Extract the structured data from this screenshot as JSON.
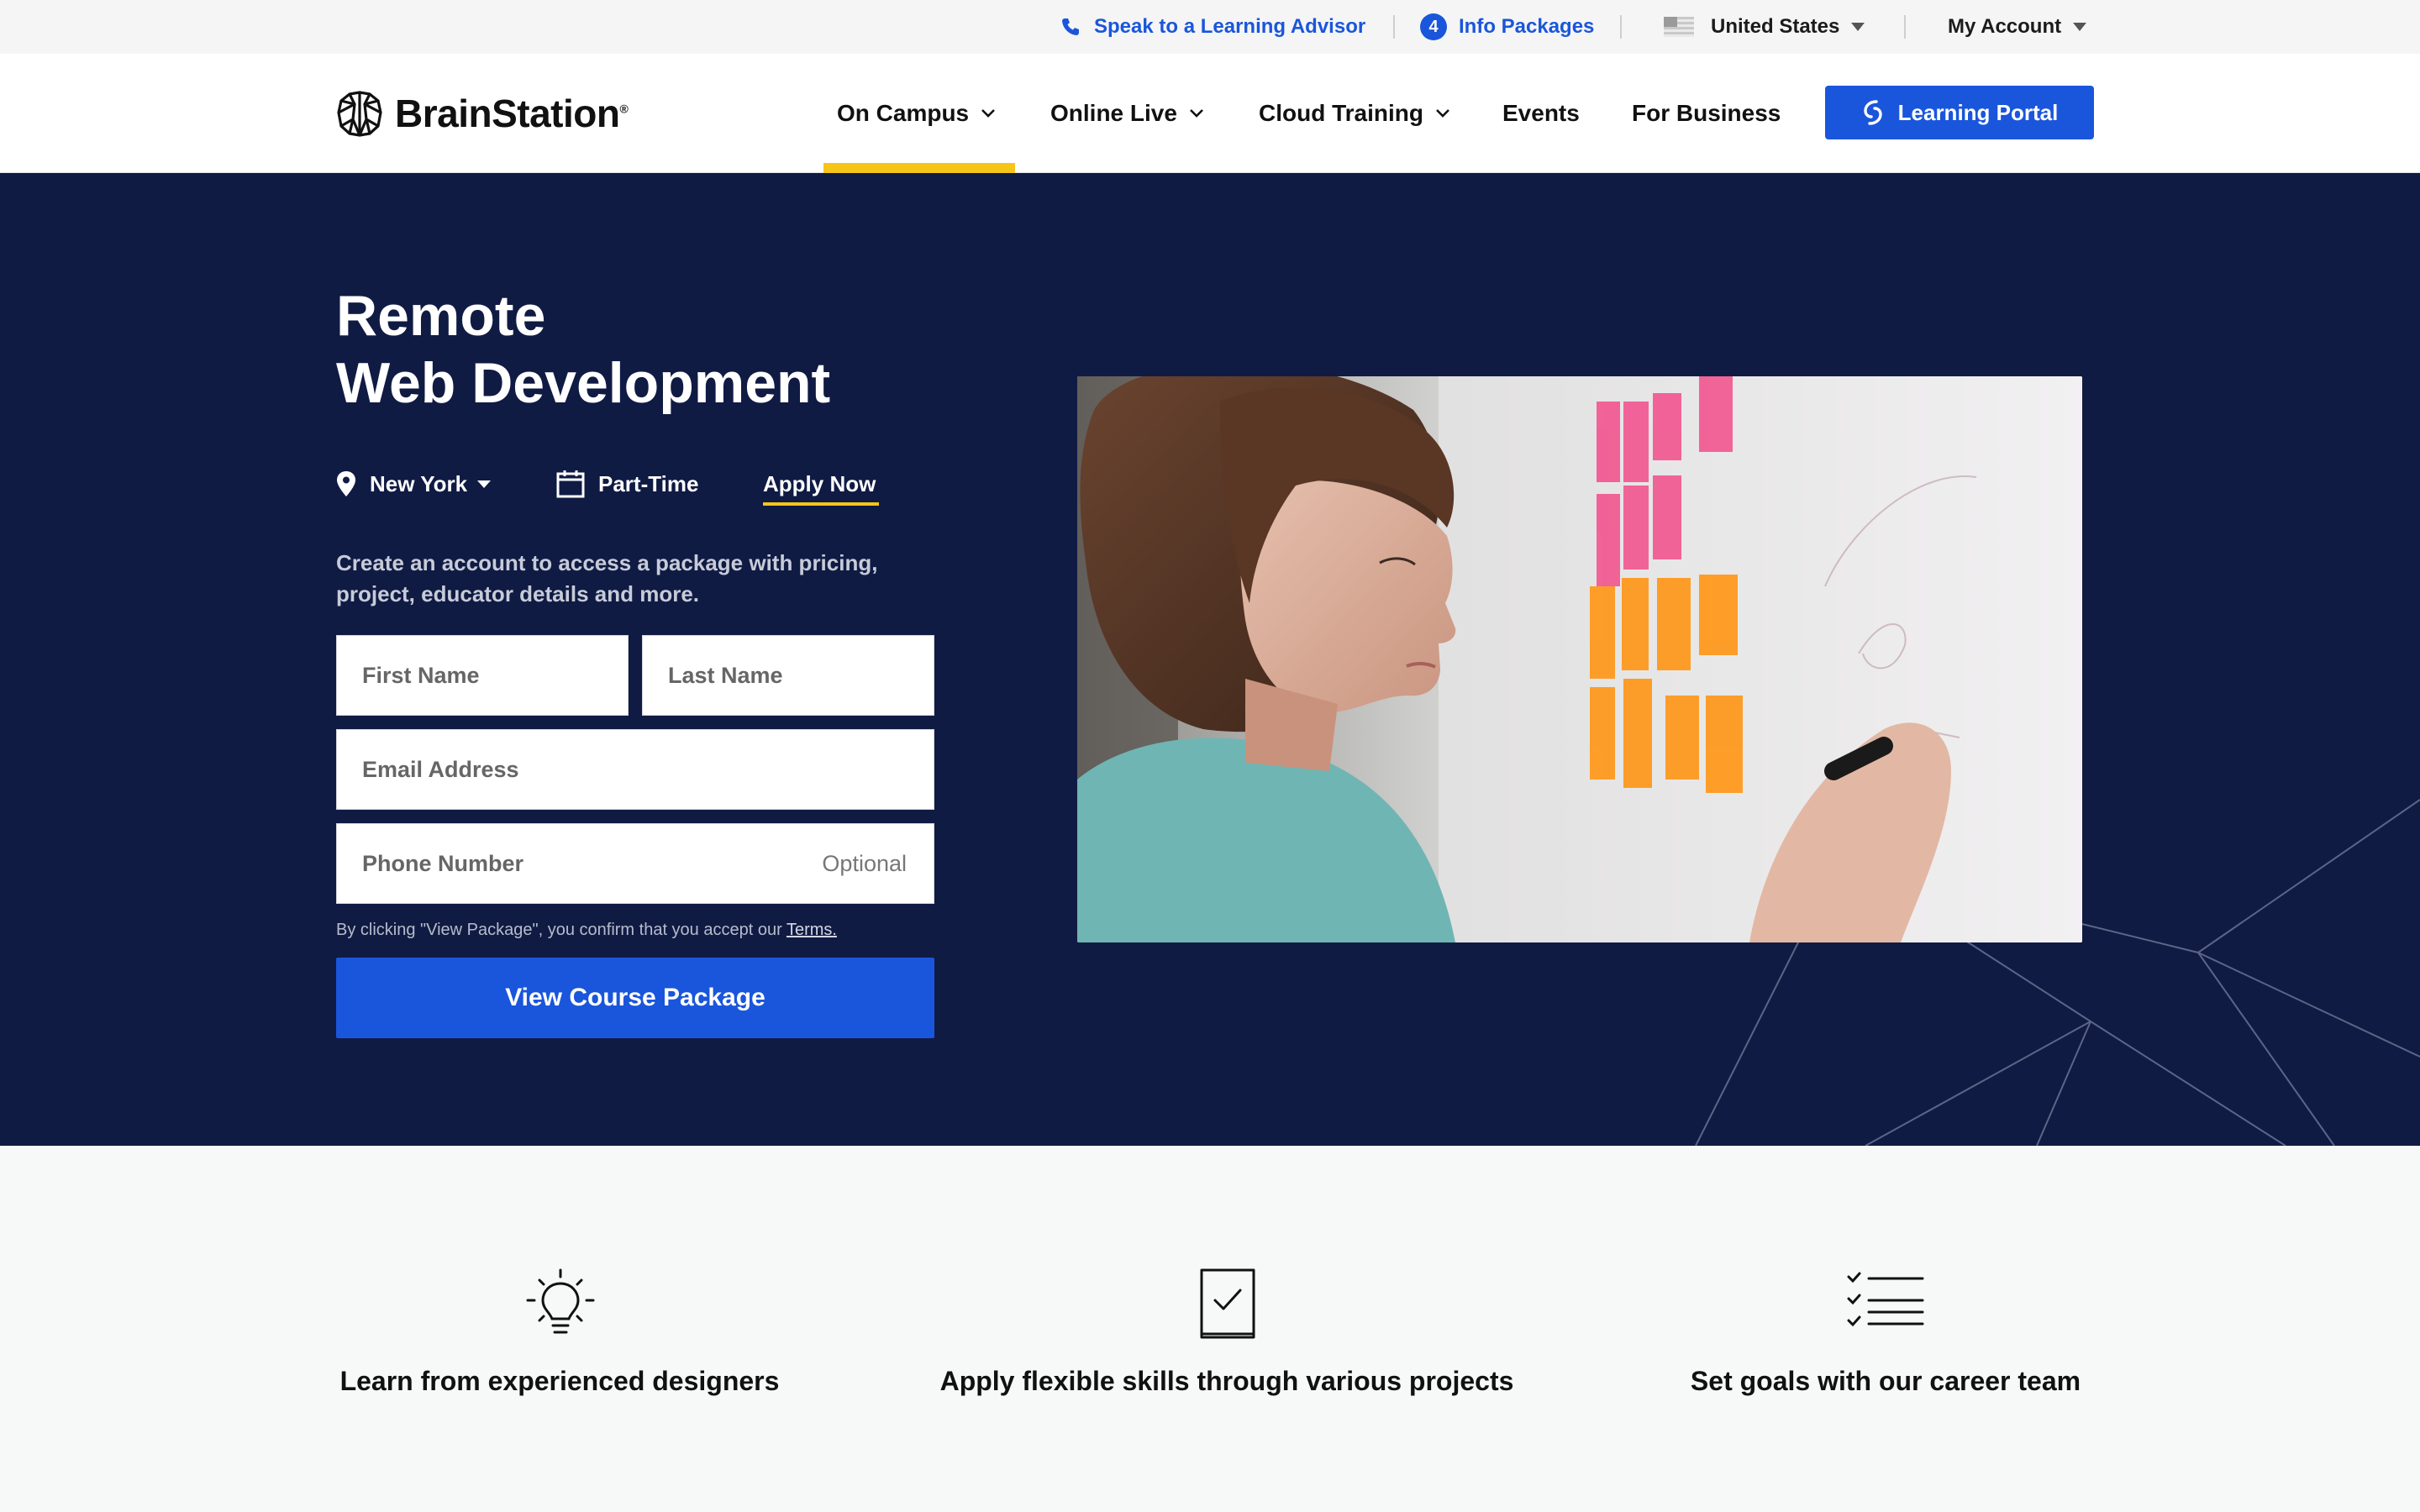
{
  "utility": {
    "advisor_label": "Speak to a Learning Advisor",
    "info_count": "4",
    "info_label": "Info Packages",
    "country": "United States",
    "account": "My Account"
  },
  "brand": {
    "name": "BrainStation",
    "reg": "®"
  },
  "nav": {
    "items": [
      {
        "label": "On Campus"
      },
      {
        "label": "Online Live"
      },
      {
        "label": "Cloud Training"
      },
      {
        "label": "Events"
      },
      {
        "label": "For Business"
      }
    ],
    "portal": "Learning Portal"
  },
  "hero": {
    "title_line1": "Remote",
    "title_line2": "Web Development",
    "location": "New York",
    "schedule": "Part-Time",
    "apply": "Apply Now",
    "blurb": "Create an account to access a package with pricing, project, educator details and more.",
    "form": {
      "first_name": "First Name",
      "last_name": "Last Name",
      "email": "Email Address",
      "phone": "Phone Number",
      "optional": "Optional"
    },
    "terms_prefix": "By clicking \"View Package\", you confirm that you accept our ",
    "terms_link": "Terms.",
    "cta": "View Course Package"
  },
  "features": [
    {
      "icon": "lightbulb-icon",
      "label": "Learn from experienced designers"
    },
    {
      "icon": "checked-document-icon",
      "label": "Apply flexible skills through various projects"
    },
    {
      "icon": "checklist-icon",
      "label": "Set goals with our career team"
    }
  ],
  "colors": {
    "navy": "#101b44",
    "brand_blue": "#1a56db",
    "accent_yellow": "#f5c518"
  }
}
